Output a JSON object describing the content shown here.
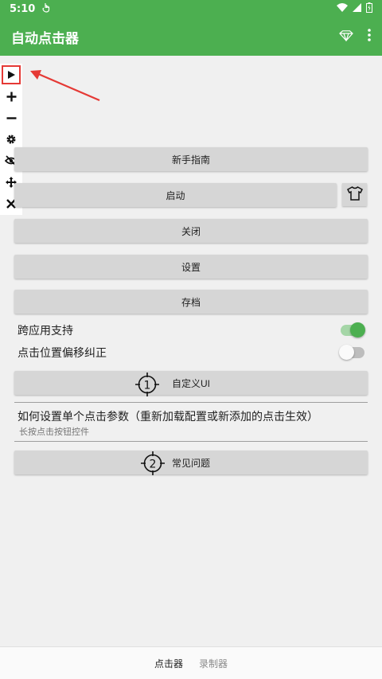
{
  "status_bar": {
    "time": "5:10"
  },
  "app_bar": {
    "title": "自动点击器"
  },
  "colors": {
    "primary": "#4caf50",
    "accent_red": "#e53935",
    "toggle_on": "#4caf50",
    "toggle_off": "#bdbdbd"
  },
  "floating_toolbar": {
    "icons": [
      "play-icon",
      "plus-icon",
      "minus-icon",
      "gear-icon",
      "eye-off-icon",
      "move-icon",
      "close-icon"
    ]
  },
  "buttons": {
    "guide": "新手指南",
    "start": "启动",
    "close": "关闭",
    "settings": "设置",
    "archive": "存档",
    "custom_ui": "自定义UI",
    "faq": "常见问题"
  },
  "toggles": {
    "cross_app": {
      "label": "跨应用支持",
      "on": true
    },
    "offset_fix": {
      "label": "点击位置偏移纠正",
      "on": false
    }
  },
  "info": {
    "title": "如何设置单个点击参数（重新加载配置或新添加的点击生效）",
    "subtitle": "长按点击按钮控件"
  },
  "markers": {
    "one": "1",
    "two": "2"
  },
  "bottom_nav": {
    "tabs": [
      "点击器",
      "录制器"
    ],
    "active": 0
  }
}
